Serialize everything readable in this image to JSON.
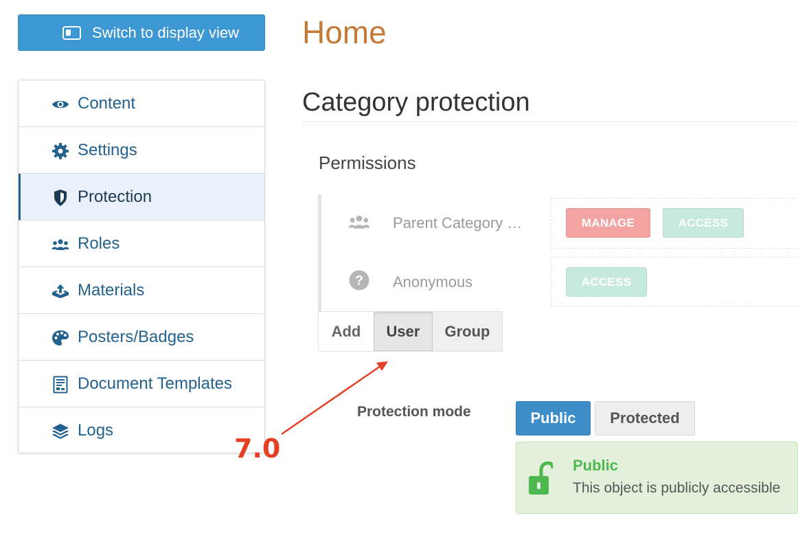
{
  "switch_button": {
    "label": "Switch to display view",
    "icon": "display-view-icon"
  },
  "page_title": "Home",
  "sidebar": {
    "items": [
      {
        "label": "Content",
        "icon": "eye-icon",
        "active": false
      },
      {
        "label": "Settings",
        "icon": "gear-icon",
        "active": false
      },
      {
        "label": "Protection",
        "icon": "shield-icon",
        "active": true
      },
      {
        "label": "Roles",
        "icon": "users-icon",
        "active": false
      },
      {
        "label": "Materials",
        "icon": "upload-box-icon",
        "active": false
      },
      {
        "label": "Posters/Badges",
        "icon": "palette-icon",
        "active": false
      },
      {
        "label": "Document Templates",
        "icon": "document-icon",
        "active": false
      },
      {
        "label": "Logs",
        "icon": "layers-icon",
        "active": false
      }
    ]
  },
  "section_title": "Category protection",
  "permissions": {
    "heading": "Permissions",
    "rows": [
      {
        "principal": "Parent Category …",
        "icon": "users-icon",
        "badges": [
          "MANAGE",
          "ACCESS"
        ]
      },
      {
        "principal": "Anonymous",
        "icon": "question-circle-icon",
        "badges": [
          "ACCESS"
        ]
      }
    ],
    "add_bar": {
      "add_label": "Add",
      "user_label": "User",
      "group_label": "Group"
    }
  },
  "protection_mode": {
    "label": "Protection mode",
    "public_label": "Public",
    "protected_label": "Protected",
    "selected": "Public",
    "alert_title": "Public",
    "alert_text": "This object is publicly accessible"
  },
  "annotation": {
    "label": "7.0",
    "color": "#e54024"
  },
  "colors": {
    "primary": "#3d97d3",
    "title_orange": "#c47a37",
    "link_blue": "#23628f",
    "manage_red": "#f3a4a2",
    "access_green": "#c8e9de",
    "success_green": "#4cb84e"
  }
}
